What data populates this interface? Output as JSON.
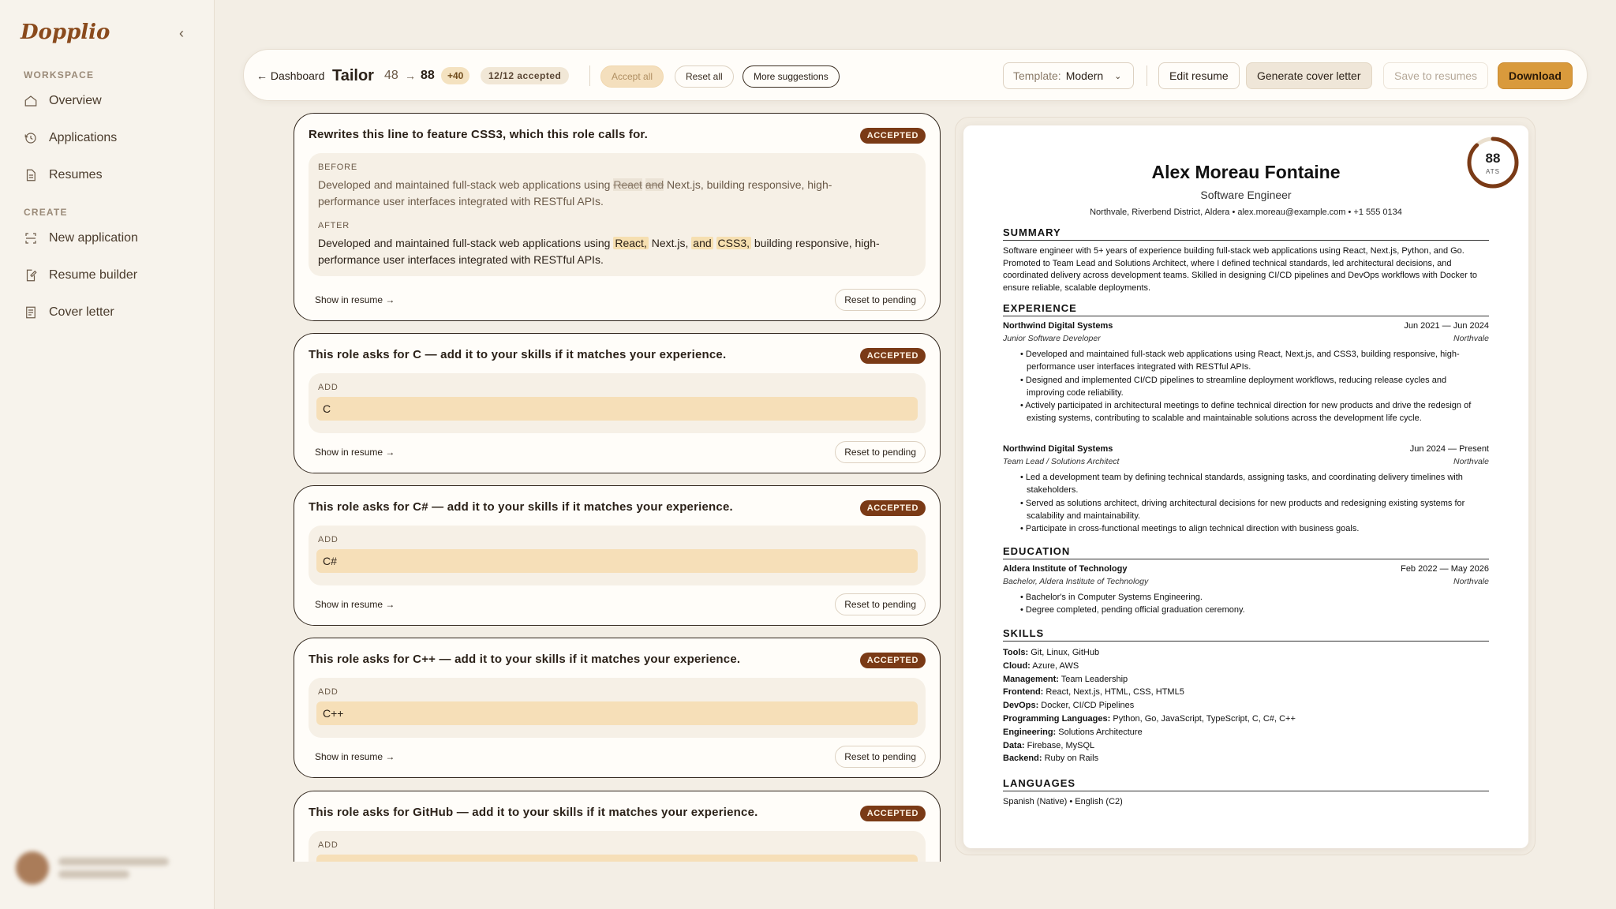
{
  "app": {
    "logo": "Dopplio",
    "collapse_icon": "‹"
  },
  "sidebar": {
    "sections": [
      {
        "label": "WORKSPACE",
        "items": [
          {
            "label": "Overview",
            "icon": "home-icon"
          },
          {
            "label": "Applications",
            "icon": "history-icon"
          },
          {
            "label": "Resumes",
            "icon": "document-icon"
          }
        ]
      },
      {
        "label": "CREATE",
        "items": [
          {
            "label": "New application",
            "icon": "scan-icon"
          },
          {
            "label": "Resume builder",
            "icon": "edit-document-icon"
          },
          {
            "label": "Cover letter",
            "icon": "letter-icon"
          }
        ]
      }
    ]
  },
  "toolbar": {
    "back_label": "← Dashboard",
    "title": "Tailor",
    "score_from": "48",
    "score_arrow": "→",
    "score_to": "88",
    "delta": "+40",
    "accepted": "12/12 accepted",
    "accept_all": "Accept all",
    "reset_all": "Reset all",
    "more_suggestions": "More suggestions",
    "template_label": "Template:",
    "template_value": "Modern",
    "edit_resume": "Edit resume",
    "generate_cover": "Generate cover letter",
    "save_resumes": "Save to resumes",
    "download": "Download"
  },
  "suggestions": [
    {
      "title": "Rewrites this line to feature CSS3, which this role calls for.",
      "status": "ACCEPTED",
      "before_label": "BEFORE",
      "before_pre": "Developed and maintained full-stack web applications using ",
      "before_strike1": "React",
      "before_strike2": "and",
      "before_post": " Next.js, building responsive, high-performance user interfaces integrated with RESTful APIs.",
      "after_label": "AFTER",
      "after_pre": "Developed and maintained full-stack web applications using ",
      "after_hl1": "React,",
      "after_mid": " Next.js, ",
      "after_hl2": "and",
      "after_hl3": "CSS3,",
      "after_post": " building responsive, high-performance user interfaces integrated with RESTful APIs.",
      "show_link": "Show in resume →",
      "reset": "Reset to pending"
    },
    {
      "title": "This role asks for C — add it to your skills if it matches your experience.",
      "status": "ACCEPTED",
      "add_label": "ADD",
      "value": "C",
      "show_link": "Show in resume →",
      "reset": "Reset to pending"
    },
    {
      "title": "This role asks for C# — add it to your skills if it matches your experience.",
      "status": "ACCEPTED",
      "add_label": "ADD",
      "value": "C#",
      "show_link": "Show in resume →",
      "reset": "Reset to pending"
    },
    {
      "title": "This role asks for C++ — add it to your skills if it matches your experience.",
      "status": "ACCEPTED",
      "add_label": "ADD",
      "value": "C++",
      "show_link": "Show in resume →",
      "reset": "Reset to pending"
    },
    {
      "title": "This role asks for GitHub — add it to your skills if it matches your experience.",
      "status": "ACCEPTED",
      "add_label": "ADD",
      "value": ""
    }
  ],
  "resume": {
    "ats_score": "88",
    "ats_label": "ATS",
    "ats_fraction": 0.88,
    "name": "Alex Moreau Fontaine",
    "role": "Software Engineer",
    "contact": "Northvale, Riverbend District, Aldera • alex.moreau@example.com • +1 555 0134",
    "summary_title": "SUMMARY",
    "summary": "Software engineer with 5+ years of experience building full-stack web applications using React, Next.js, Python, and Go. Promoted to Team Lead and Solutions Architect, where I defined technical standards, led architectural decisions, and coordinated delivery across development teams. Skilled in designing CI/CD pipelines and DevOps workflows with Docker to ensure reliable, scalable deployments.",
    "experience_title": "EXPERIENCE",
    "jobs": [
      {
        "company": "Northwind Digital Systems",
        "dates": "Jun 2021 — Jun 2024",
        "title": "Junior Software Developer",
        "location": "Northvale",
        "bullets": [
          "• Developed and maintained full-stack web applications using React, Next.js, and CSS3, building responsive, high-performance user interfaces integrated with RESTful APIs.",
          "• Designed and implemented CI/CD pipelines to streamline deployment workflows, reducing release cycles and improving code reliability.",
          "• Actively participated in architectural meetings to define technical direction for new products and drive the redesign of existing systems, contributing to scalable and maintainable solutions across the development life cycle."
        ]
      },
      {
        "company": "Northwind Digital Systems",
        "dates": "Jun 2024 — Present",
        "title": "Team Lead / Solutions Architect",
        "location": "Northvale",
        "bullets": [
          "• Led a development team by defining technical standards, assigning tasks, and coordinating delivery timelines with stakeholders.",
          "• Served as solutions architect, driving architectural decisions for new products and redesigning existing systems for scalability and maintainability.",
          "• Participate in cross-functional meetings to align technical direction with business goals."
        ]
      }
    ],
    "education_title": "EDUCATION",
    "education": {
      "school": "Aldera Institute of Technology",
      "dates": "Feb 2022 — May 2026",
      "degree": "Bachelor, Aldera Institute of Technology",
      "location": "Northvale",
      "bullets": [
        "• Bachelor's in Computer Systems Engineering.",
        "• Degree completed, pending official graduation ceremony."
      ]
    },
    "skills_title": "SKILLS",
    "skills": [
      {
        "k": "Tools:",
        "v": " Git, Linux, GitHub"
      },
      {
        "k": "Cloud:",
        "v": " Azure, AWS"
      },
      {
        "k": "Management:",
        "v": " Team Leadership"
      },
      {
        "k": "Frontend:",
        "v": " React, Next.js, HTML, CSS, HTML5"
      },
      {
        "k": "DevOps:",
        "v": " Docker, CI/CD Pipelines"
      },
      {
        "k": "Programming Languages:",
        "v": " Python, Go, JavaScript, TypeScript, C, C#, C++"
      },
      {
        "k": "Engineering:",
        "v": " Solutions Architecture"
      },
      {
        "k": "Data:",
        "v": " Firebase, MySQL"
      },
      {
        "k": "Backend:",
        "v": " Ruby on Rails"
      }
    ],
    "languages_title": "LANGUAGES",
    "languages": "Spanish (Native) • English (C2)"
  },
  "colors": {
    "accent": "#d99a3c",
    "badge": "#7a3a16",
    "brand": "#8a4a1c"
  }
}
